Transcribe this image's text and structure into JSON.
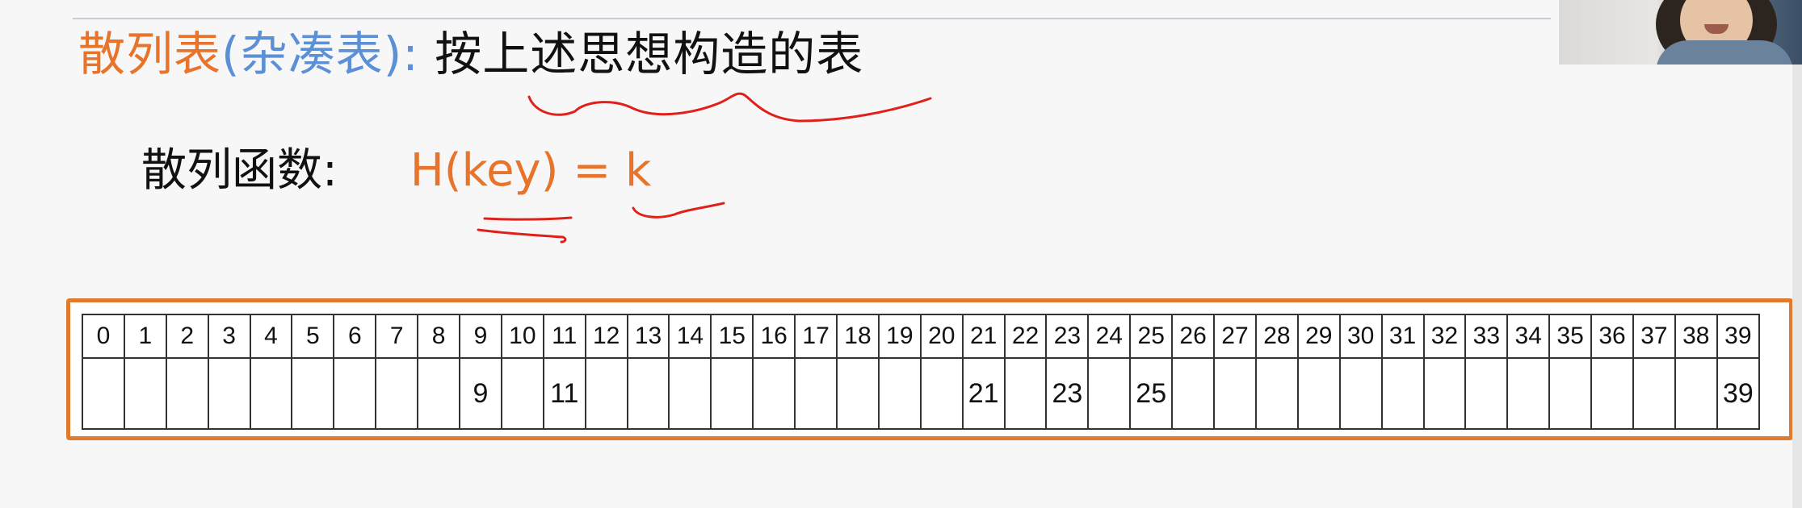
{
  "title": {
    "term": "散列表",
    "paren": "(杂凑表)",
    "colon": ":",
    "rest": "按上述思想构造的表"
  },
  "hash_function": {
    "label": "散列函数:",
    "formula": "H(key) = k"
  },
  "hash_table": {
    "indices": [
      "0",
      "1",
      "2",
      "3",
      "4",
      "5",
      "6",
      "7",
      "8",
      "9",
      "10",
      "11",
      "12",
      "13",
      "14",
      "15",
      "16",
      "17",
      "18",
      "19",
      "20",
      "21",
      "22",
      "23",
      "24",
      "25",
      "26",
      "27",
      "28",
      "29",
      "30",
      "31",
      "32",
      "33",
      "34",
      "35",
      "36",
      "37",
      "38",
      "39"
    ],
    "values": [
      "",
      "",
      "",
      "",
      "",
      "",
      "",
      "",
      "",
      "9",
      "",
      "11",
      "",
      "",
      "",
      "",
      "",
      "",
      "",
      "",
      "",
      "21",
      "",
      "23",
      "",
      "25",
      "",
      "",
      "",
      "",
      "",
      "",
      "",
      "",
      "",
      "",
      "",
      "",
      "",
      "39"
    ]
  },
  "annotation_colors": {
    "ink": "#e0201a",
    "frame": "#e07a2c",
    "term": "#e8742b",
    "paren": "#5b8fd6"
  }
}
